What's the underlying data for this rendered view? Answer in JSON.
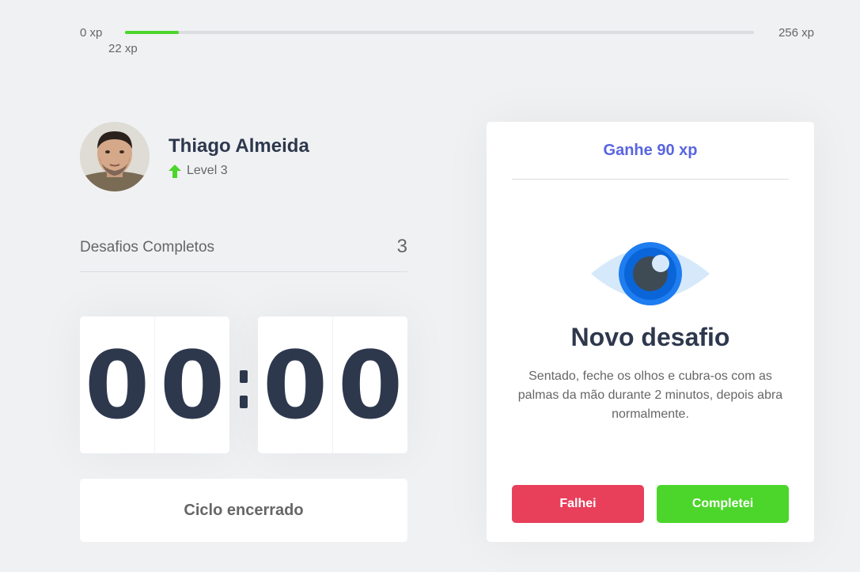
{
  "xp": {
    "start_label": "0 xp",
    "current_label": "22 xp",
    "end_label": "256 xp",
    "progress_fraction": 0.086,
    "fill_color": "#4cd62b"
  },
  "profile": {
    "name": "Thiago Almeida",
    "level_label": "Level 3",
    "level_icon": "level-up-arrow-icon"
  },
  "completed": {
    "label": "Desafios Completos",
    "count": "3"
  },
  "countdown": {
    "minute_left": "0",
    "minute_right": "0",
    "second_left": "0",
    "second_right": "0"
  },
  "cycle_button": {
    "label": "Ciclo encerrado"
  },
  "challenge": {
    "reward": "Ganhe 90 xp",
    "icon": "eye-icon",
    "title": "Novo desafio",
    "description": "Sentado, feche os olhos e cubra-os com as palmas da mão durante 2 minutos, depois abra normalmente.",
    "failed_label": "Falhei",
    "succeeded_label": "Completei"
  },
  "colors": {
    "background": "#f0f1f3",
    "title": "#2e384d",
    "text": "#666666",
    "blue": "#5965e0",
    "red": "#e83f5b",
    "green": "#4cd62b"
  }
}
